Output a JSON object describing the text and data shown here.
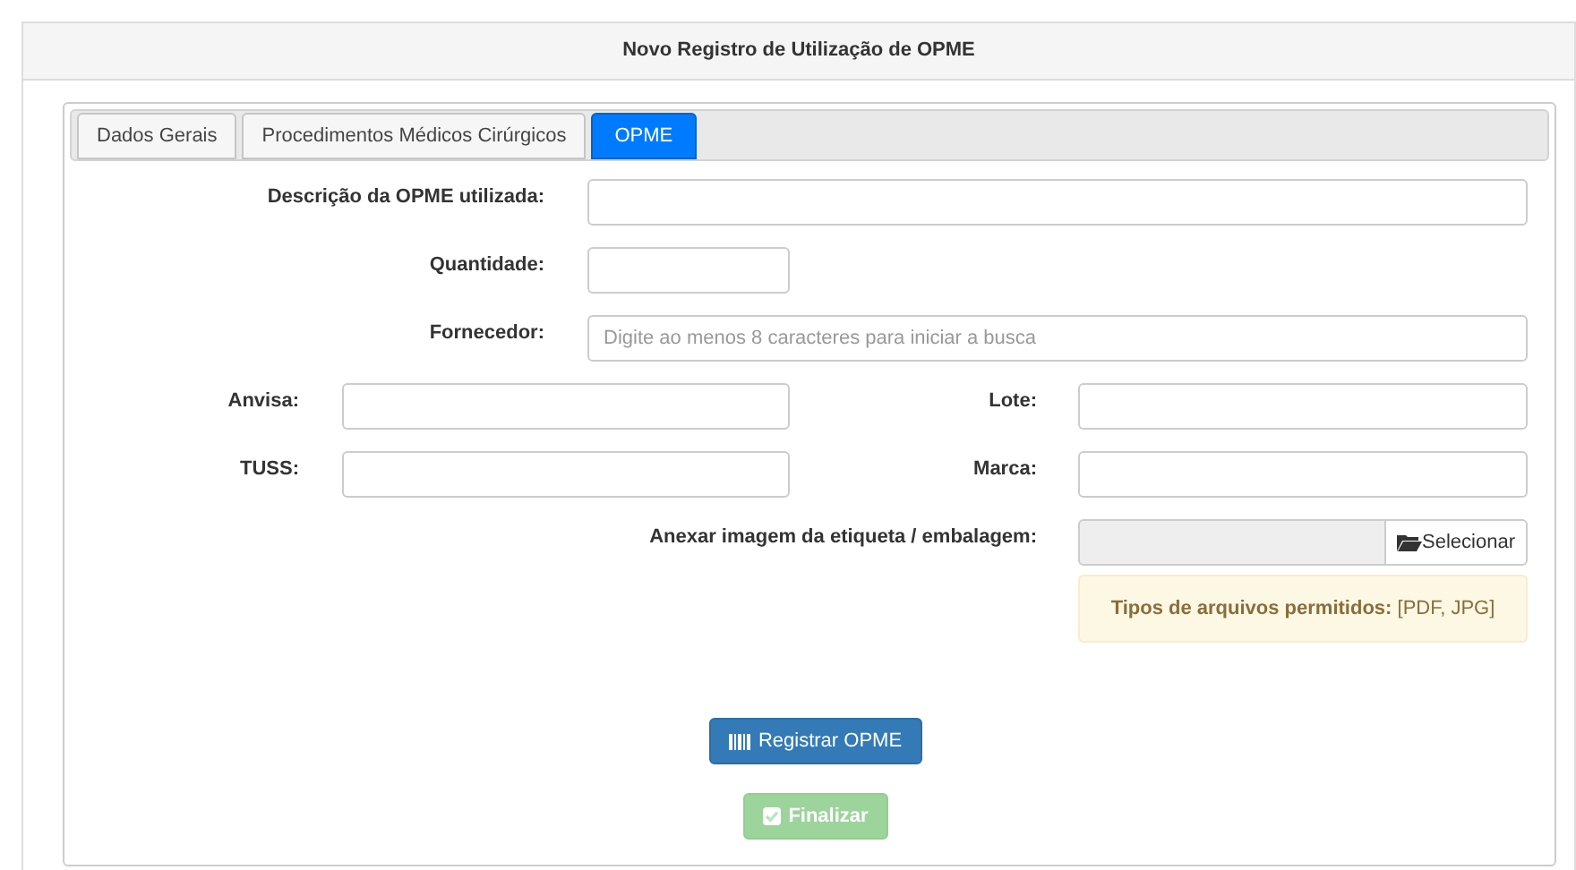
{
  "panel": {
    "title": "Novo Registro de Utilização de OPME"
  },
  "tabs": [
    {
      "label": "Dados Gerais",
      "selected": false
    },
    {
      "label": "Procedimentos Médicos Cirúrgicos",
      "selected": false
    },
    {
      "label": "OPME",
      "selected": true
    }
  ],
  "wide_fields": [
    {
      "label": "Descrição da OPME utilizada:",
      "kind": "wide"
    },
    {
      "label": "Quantidade:",
      "kind": "short"
    },
    {
      "label": "Fornecedor:",
      "kind": "wide",
      "placeholder": "Digite ao menos 8 caracteres para iniciar a busca"
    }
  ],
  "pair_rows": [
    [
      {
        "label": "Anvisa:"
      },
      {
        "label": "Lote:"
      }
    ],
    [
      {
        "label": "TUSS:"
      },
      {
        "label": "Marca:"
      }
    ]
  ],
  "attachment": {
    "label": "Anexar imagem da etiqueta / embalagem:",
    "button": "Selecionar",
    "note": "**Tipos de arquivos permitidos:** [PDF, JPG]"
  },
  "buttons": [
    {
      "label": "Registrar OPME",
      "kind": "primary",
      "disabled": false
    },
    {
      "label": "Finalizar",
      "kind": "success",
      "disabled": true
    }
  ]
}
